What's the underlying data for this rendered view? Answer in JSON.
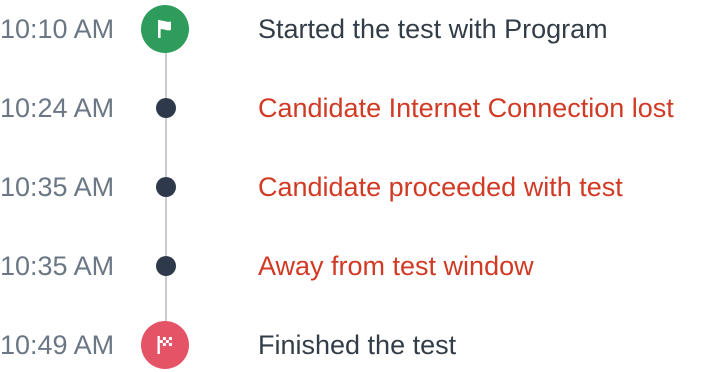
{
  "colors": {
    "time_text": "#6b7785",
    "normal_text": "#333d48",
    "alert_text": "#d13a24",
    "start_marker": "#2e9d5b",
    "finish_marker": "#e55466",
    "dot": "#2e3a4b",
    "line": "#c8ccd1"
  },
  "events": [
    {
      "time": "10:10 AM",
      "text": "Started the test with Program",
      "marker": "flag-icon",
      "status": "normal"
    },
    {
      "time": "10:24 AM",
      "text": "Candidate Internet Connection lost",
      "marker": "dot",
      "status": "alert"
    },
    {
      "time": "10:35 AM",
      "text": "Candidate proceeded with test",
      "marker": "dot",
      "status": "alert"
    },
    {
      "time": "10:35 AM",
      "text": "Away from test window",
      "marker": "dot",
      "status": "alert"
    },
    {
      "time": "10:49 AM",
      "text": "Finished the test",
      "marker": "checkered-flag-icon",
      "status": "normal"
    }
  ]
}
